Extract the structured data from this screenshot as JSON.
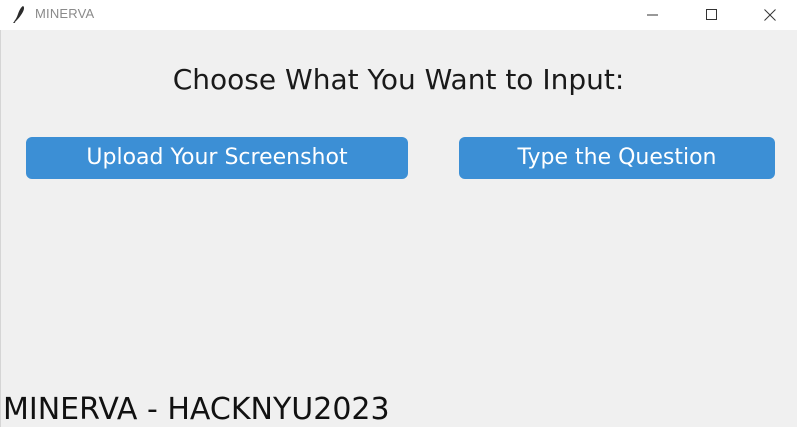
{
  "window": {
    "title": "MINERVA",
    "icon": "feather-icon",
    "controls": {
      "minimize": "minimize-icon",
      "maximize": "maximize-icon",
      "close": "close-icon"
    }
  },
  "main": {
    "heading": "Choose What You Want to Input:",
    "upload_button": "Upload Your Screenshot",
    "type_button": "Type the Question",
    "footer_text": "MINERVA - HACKNYU2023"
  },
  "colors": {
    "button_bg": "#3c8fd5",
    "button_text": "#ffffff",
    "background": "#f0f0f0",
    "titlebar": "#ffffff"
  }
}
